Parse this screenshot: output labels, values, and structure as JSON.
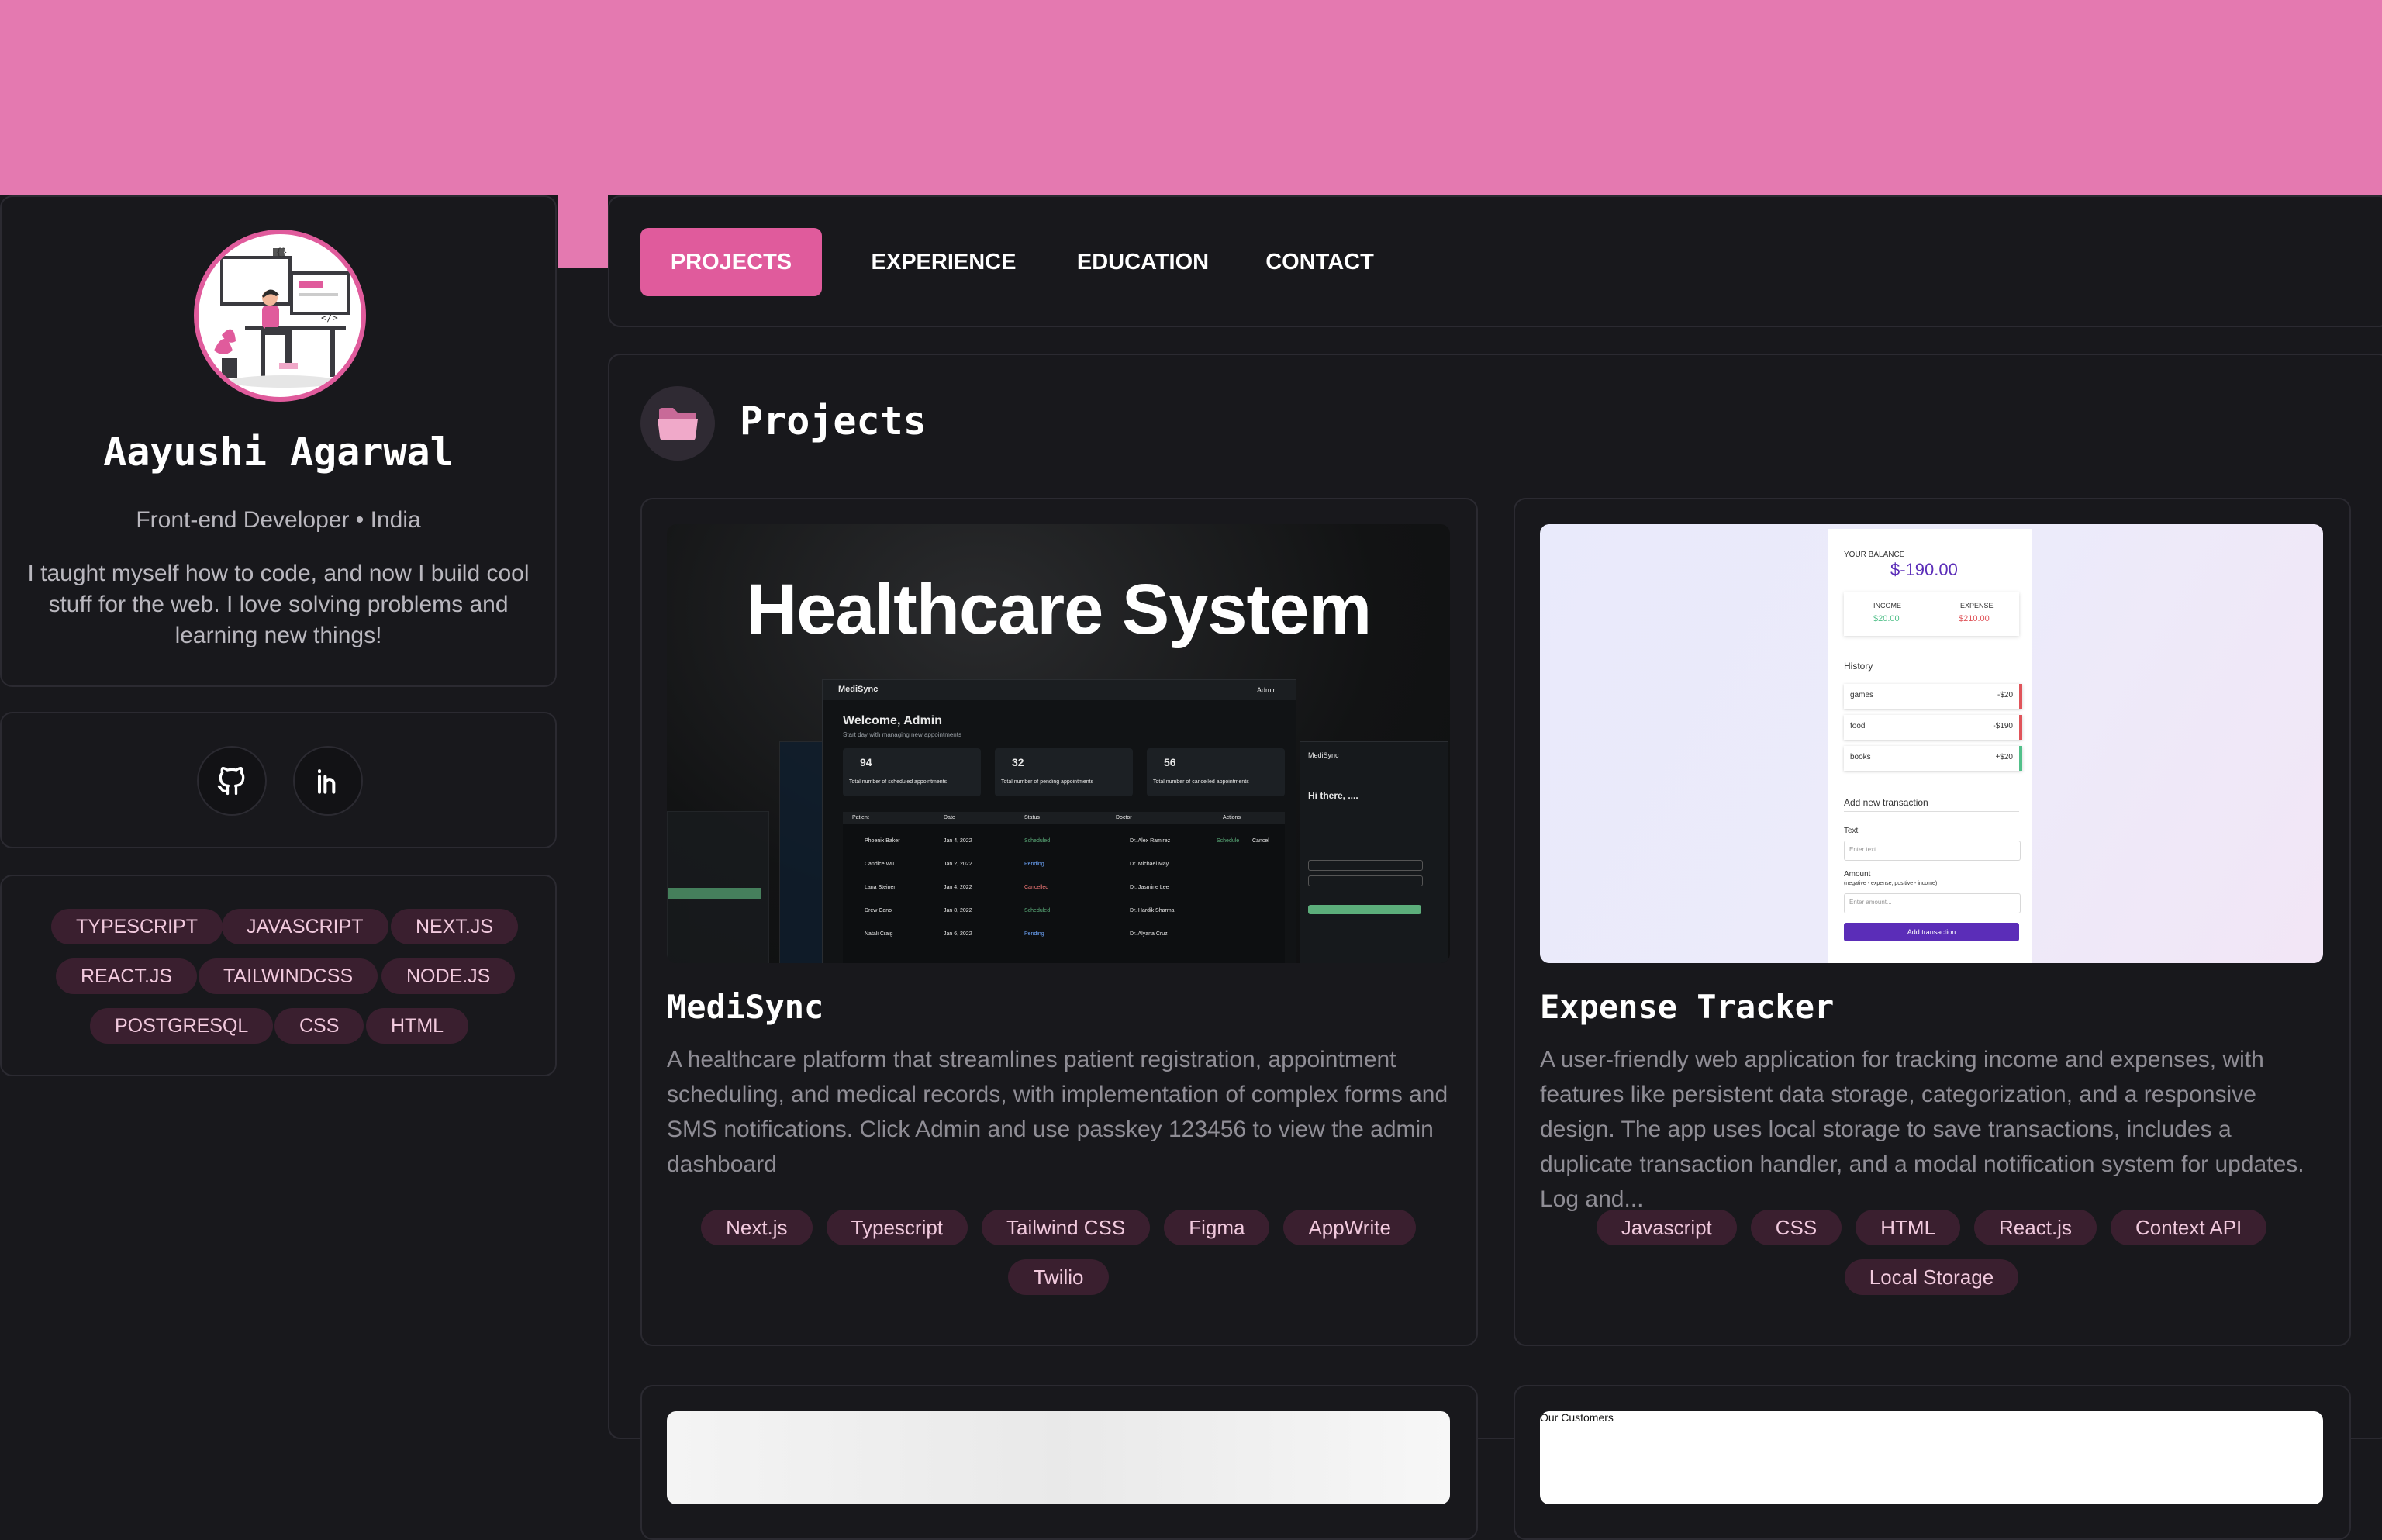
{
  "colors": {
    "accent": "#e05b9c",
    "banner": "#e479b0",
    "background": "#18181c",
    "chip_bg": "#3a1f2f",
    "chip_text": "#f1c9dd"
  },
  "profile": {
    "name": "Aayushi Agarwal",
    "role": "Front-end Developer • India",
    "bio": "I taught myself how to code, and now I build cool stuff for the web. I love solving problems and learning new things!"
  },
  "social": [
    {
      "name": "github",
      "icon": "github-icon"
    },
    {
      "name": "linkedin",
      "icon": "linkedin-icon"
    }
  ],
  "skills": [
    "TYPESCRIPT",
    "JAVASCRIPT",
    "NEXT.JS",
    "REACT.JS",
    "TAILWINDCSS",
    "NODE.JS",
    "POSTGRESQL",
    "CSS",
    "HTML"
  ],
  "nav": {
    "tabs": [
      {
        "label": "PROJECTS",
        "active": true
      },
      {
        "label": "EXPERIENCE",
        "active": false
      },
      {
        "label": "EDUCATION",
        "active": false
      },
      {
        "label": "CONTACT",
        "active": false
      }
    ]
  },
  "section": {
    "title": "Projects",
    "icon": "folder-icon"
  },
  "projects": [
    {
      "title": "MediSync",
      "description": "A healthcare platform that streamlines patient registration, appointment scheduling, and medical records, with implementation of complex forms and SMS notifications. Click Admin and use passkey 123456 to view the admin dashboard",
      "tags": [
        "Next.js",
        "Typescript",
        "Tailwind CSS",
        "Figma",
        "AppWrite",
        "Twilio"
      ],
      "thumbnail": {
        "heading": "Healthcare System",
        "app_name": "MediSync",
        "user": "Admin",
        "welcome": "Welcome, Admin",
        "subtitle": "Start day with managing new appointments",
        "stats": [
          {
            "value": "94",
            "label": "Total number of scheduled appointments"
          },
          {
            "value": "32",
            "label": "Total number of pending appointments"
          },
          {
            "value": "56",
            "label": "Total number of cancelled appointments"
          }
        ],
        "columns": [
          "Patient",
          "Date",
          "Status",
          "Doctor",
          "Actions"
        ],
        "rows": [
          {
            "patient": "Phoenix Baker",
            "date": "Jan 4, 2022",
            "status": "Scheduled",
            "doctor": "Dr. Alex Ramirez"
          },
          {
            "patient": "Candice Wu",
            "date": "Jan 2, 2022",
            "status": "Pending",
            "doctor": "Dr. Michael May"
          },
          {
            "patient": "Lana Steiner",
            "date": "Jan 4, 2022",
            "status": "Cancelled",
            "doctor": "Dr. Jasmine Lee"
          },
          {
            "patient": "Drew Cano",
            "date": "Jan 8, 2022",
            "status": "Scheduled",
            "doctor": "Dr. Hardik Sharma"
          },
          {
            "patient": "Natali Craig",
            "date": "Jan 6, 2022",
            "status": "Pending",
            "doctor": "Dr. Alyana Cruz"
          }
        ],
        "actions": [
          "Schedule",
          "Cancel"
        ],
        "side_greeting": "Hi there, ...."
      }
    },
    {
      "title": "Expense Tracker",
      "description": "A user-friendly web application for tracking income and expenses, with features like persistent data storage, categorization, and a responsive design. The app uses local storage to save transactions, includes a duplicate transaction handler, and a modal notification system for updates. Log and...",
      "tags": [
        "Javascript",
        "CSS",
        "HTML",
        "React.js",
        "Context API",
        "Local Storage"
      ],
      "thumbnail": {
        "balance_label": "YOUR BALANCE",
        "balance": "$-190.00",
        "income_label": "INCOME",
        "income": "$20.00",
        "expense_label": "EXPENSE",
        "expense": "$210.00",
        "history_label": "History",
        "history": [
          {
            "name": "games",
            "amount": "-$20"
          },
          {
            "name": "food",
            "amount": "-$190"
          },
          {
            "name": "books",
            "amount": "+$20"
          }
        ],
        "add_label": "Add new transaction",
        "text_label": "Text",
        "text_placeholder": "Enter text...",
        "amount_label": "Amount",
        "amount_hint": "(negative - expense, positive - income)",
        "amount_placeholder": "Enter amount...",
        "button": "Add transaction"
      }
    },
    {
      "title": ""
    },
    {
      "caption": "Our Customers"
    }
  ]
}
